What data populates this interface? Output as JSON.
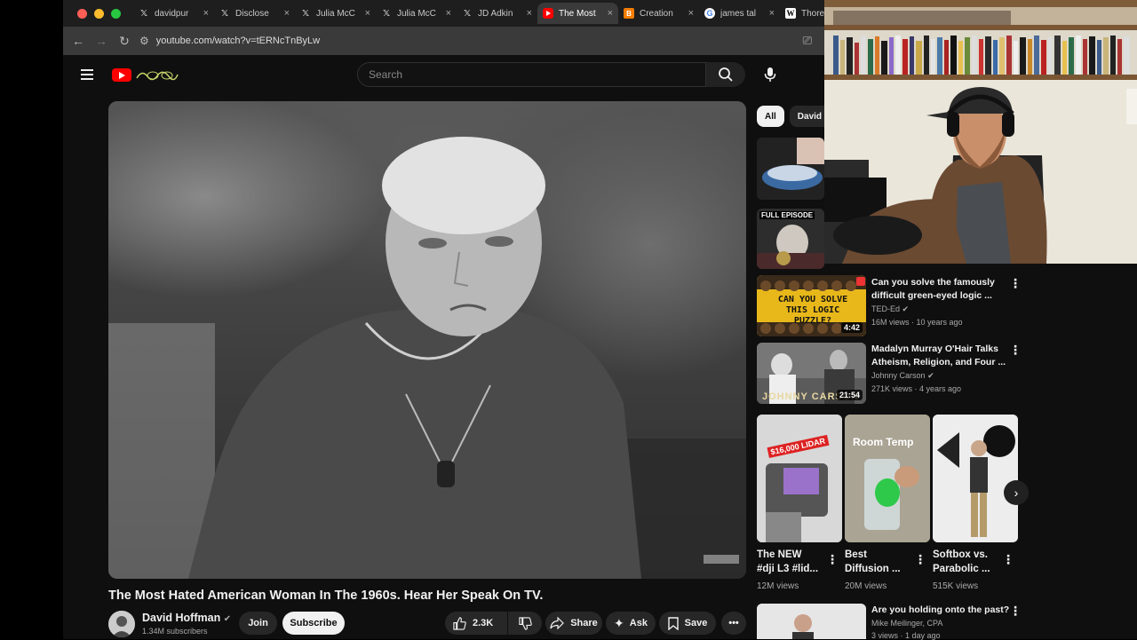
{
  "browser": {
    "tabs": [
      {
        "label": "davidpur",
        "icon": "x-icon"
      },
      {
        "label": "Disclose",
        "icon": "x-icon"
      },
      {
        "label": "Julia McC",
        "icon": "x-icon"
      },
      {
        "label": "Julia McC",
        "icon": "x-icon"
      },
      {
        "label": "JD Adkin",
        "icon": "x-icon"
      },
      {
        "label": "The Most",
        "icon": "youtube-icon",
        "active": true
      },
      {
        "label": "Creation",
        "icon": "blogger-icon"
      },
      {
        "label": "james tal",
        "icon": "google-icon"
      },
      {
        "label": "Thorea",
        "icon": "wikipedia-icon"
      }
    ],
    "url": "youtube.com/watch?v=tERNcTnByLw"
  },
  "youtube": {
    "search_placeholder": "Search",
    "video": {
      "title": "The Most Hated American Woman In The 1960s. Hear Her Speak On TV.",
      "channel": "David Hoffman",
      "subscribers": "1.34M subscribers",
      "join_label": "Join",
      "subscribe_label": "Subscribe",
      "likes": "2.3K",
      "share_label": "Share",
      "ask_label": "Ask",
      "save_label": "Save"
    },
    "chips": [
      "All",
      "David H"
    ],
    "sidebar": {
      "thumb2_text": "FULL EPISODE",
      "items": [
        {
          "title1": "Can you solve the famously",
          "title2": "difficult green-eyed logic ...",
          "channel": "TED-Ed",
          "meta": "16M views · 10 years ago",
          "duration": "4:42",
          "thumb_text": "CAN YOU SOLVE THIS LOGIC PUZZLE?"
        },
        {
          "title1": "Madalyn Murray O'Hair Talks",
          "title2": "Atheism, Religion, and Four ...",
          "channel": "Johnny Carson",
          "meta": "271K views · 4 years ago",
          "duration": "21:54",
          "thumb_text": "JOHNNY CARSON"
        },
        {
          "title1": "Are you holding onto the past?",
          "title2": "",
          "channel": "Mike Meilinger, CPA",
          "meta": "3 views · 1 day ago",
          "duration": "",
          "thumb_text": ""
        }
      ],
      "shorts": [
        {
          "title1": "The NEW",
          "title2": "#dji L3 #lid...",
          "views": "12M views",
          "thumb_text": "$16,000 LIDAR"
        },
        {
          "title1": "Best",
          "title2": "Diffusion ...",
          "views": "20M views",
          "thumb_text": "Room Temp"
        },
        {
          "title1": "Softbox vs.",
          "title2": "Parabolic ...",
          "views": "515K views",
          "thumb_text": ""
        }
      ]
    }
  }
}
